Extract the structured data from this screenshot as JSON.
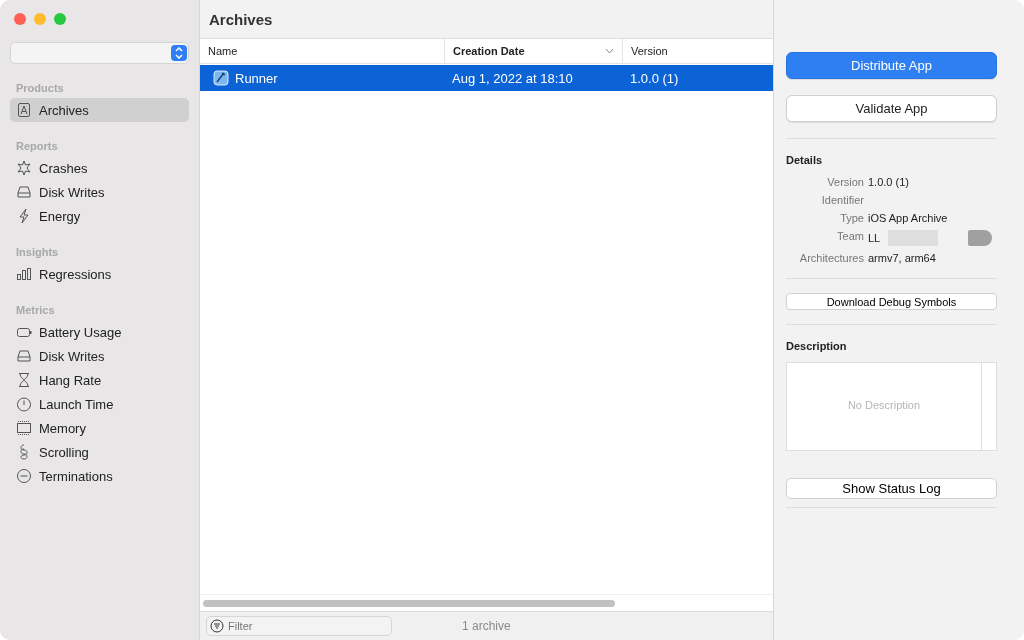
{
  "window": {
    "title": "Archives"
  },
  "sidebar": {
    "sections": [
      {
        "title": "Products",
        "items": [
          {
            "label": "Archives",
            "kind": "archive",
            "selected": true
          }
        ]
      },
      {
        "title": "Reports",
        "items": [
          {
            "label": "Crashes",
            "kind": "crash",
            "selected": false
          },
          {
            "label": "Disk Writes",
            "kind": "disk",
            "selected": false
          },
          {
            "label": "Energy",
            "kind": "energy",
            "selected": false
          }
        ]
      },
      {
        "title": "Insights",
        "items": [
          {
            "label": "Regressions",
            "kind": "bars",
            "selected": false
          }
        ]
      },
      {
        "title": "Metrics",
        "items": [
          {
            "label": "Battery Usage",
            "kind": "battery",
            "selected": false
          },
          {
            "label": "Disk Writes",
            "kind": "disk",
            "selected": false
          },
          {
            "label": "Hang Rate",
            "kind": "hourglass",
            "selected": false
          },
          {
            "label": "Launch Time",
            "kind": "clock",
            "selected": false
          },
          {
            "label": "Memory",
            "kind": "memory",
            "selected": false
          },
          {
            "label": "Scrolling",
            "kind": "scroll",
            "selected": false
          },
          {
            "label": "Terminations",
            "kind": "minus",
            "selected": false
          }
        ]
      }
    ]
  },
  "table": {
    "columns": [
      {
        "label": "Name",
        "sorted": false
      },
      {
        "label": "Creation Date",
        "sorted": true
      },
      {
        "label": "Version",
        "sorted": false
      }
    ],
    "rows": [
      {
        "name": "Runner",
        "date": "Aug 1, 2022 at 18:10",
        "version": "1.0.0 (1)",
        "selected": true
      }
    ]
  },
  "footer": {
    "filter": {
      "placeholder": "Filter"
    },
    "count": "1 archive"
  },
  "inspector": {
    "buttons": [
      {
        "label": "Distribute App",
        "kind": "primary"
      },
      {
        "label": "Validate App",
        "kind": "secondary"
      }
    ],
    "details_title": "Details",
    "details": [
      {
        "key": "Version",
        "value": "1.0.0 (1)"
      },
      {
        "key": "Identifier"
      },
      {
        "key": "Type",
        "value": "iOS App Archive"
      },
      {
        "key": "Team",
        "value": "LL",
        "redacted": true
      },
      {
        "key": "Architectures",
        "value": "armv7, arm64"
      }
    ],
    "debug_button": "Download Debug Symbols",
    "description_title": "Description",
    "description": {
      "placeholder": "No Description"
    },
    "log_button": "Show Status Log"
  }
}
